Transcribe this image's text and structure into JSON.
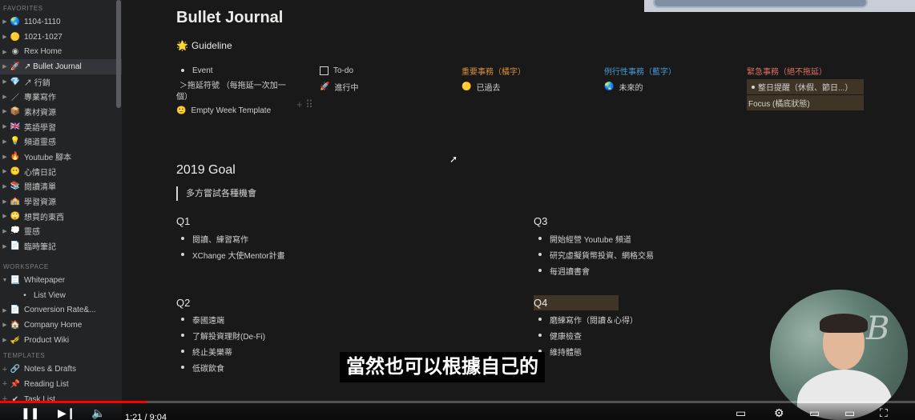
{
  "sidebar": {
    "favorites_label": "FAVORITES",
    "favorites": [
      {
        "icon": "globe-icon",
        "glyph": "🌏",
        "label": "1104-1110",
        "active": false
      },
      {
        "icon": "yellow-circle-icon",
        "glyph": "🟡",
        "label": "1021-1027",
        "active": false
      },
      {
        "icon": "avatar-icon",
        "glyph": "◉",
        "label": "Rex Home",
        "active": false
      },
      {
        "icon": "rocket-icon",
        "glyph": "🚀",
        "label": "↗ Bullet Journal",
        "active": true
      },
      {
        "icon": "diamond-icon",
        "glyph": "💎",
        "label": "↗ 行銷",
        "active": false
      },
      {
        "icon": "pen-icon",
        "glyph": "／",
        "label": "專業寫作",
        "active": false
      },
      {
        "icon": "box-icon",
        "glyph": "📦",
        "label": "素材資源",
        "active": false
      },
      {
        "icon": "uk-flag-icon",
        "glyph": "🇬🇧",
        "label": "英語學習",
        "active": false
      },
      {
        "icon": "lightbulb-icon",
        "glyph": "💡",
        "label": "頻道靈感",
        "active": false
      },
      {
        "icon": "fire-icon",
        "glyph": "🔥",
        "label": "Youtube 腳本",
        "active": false
      },
      {
        "icon": "smiley-icon",
        "glyph": "😶",
        "label": "心情日記",
        "active": false
      },
      {
        "icon": "books-icon",
        "glyph": "📚",
        "label": "閱讀清單",
        "active": false
      },
      {
        "icon": "school-icon",
        "glyph": "🏫",
        "label": "學習資源",
        "active": false
      },
      {
        "icon": "thinking-face-icon",
        "glyph": "🙄",
        "label": "想買的東西",
        "active": false
      },
      {
        "icon": "speech-bubble-icon",
        "glyph": "💭",
        "label": "靈感",
        "active": false
      },
      {
        "icon": "page-icon",
        "glyph": "📄",
        "label": "臨時筆記",
        "active": false
      }
    ],
    "workspace_label": "WORKSPACE",
    "workspace": [
      {
        "icon": "page-icon",
        "glyph": "📃",
        "label": "Whitepaper",
        "expanded": true,
        "sub": false
      },
      {
        "icon": "dot-icon",
        "glyph": "•",
        "label": "List View",
        "expanded": false,
        "sub": true
      },
      {
        "icon": "page-icon",
        "glyph": "📄",
        "label": "Conversion Rate&...",
        "expanded": false,
        "sub": false
      },
      {
        "icon": "house-icon",
        "glyph": "🏠",
        "label": "Company Home",
        "expanded": false,
        "sub": false
      },
      {
        "icon": "trumpet-icon",
        "glyph": "🎺",
        "label": "Product Wiki",
        "expanded": false,
        "sub": false
      }
    ],
    "templates_label": "TEMPLATES",
    "templates": [
      {
        "icon": "link-icon",
        "glyph": "🔗",
        "label": "Notes & Drafts"
      },
      {
        "icon": "bookmark-icon",
        "glyph": "📌",
        "label": "Reading List"
      },
      {
        "icon": "check-icon",
        "glyph": "✔",
        "label": "Task List"
      }
    ]
  },
  "page": {
    "title": "Bullet Journal",
    "guideline": {
      "icon": "sparkle-icon",
      "glyph": "🌟",
      "label": "Guideline"
    },
    "col1": {
      "event": "Event",
      "postpone": "＞拖延符號 （每拖延一次加一",
      "postpone_cont": "個）",
      "template_icon": "🙂",
      "template": "Empty Week Template"
    },
    "col2": {
      "todo": "To-do",
      "in_progress": "進行中",
      "in_progress_glyph": "🚀"
    },
    "col3": {
      "header": "重要事務（橘字）",
      "item": "已過去",
      "item_glyph": "🟡"
    },
    "col4": {
      "header": "例行性事務（藍字）",
      "item": "未來的",
      "item_glyph": "🌏"
    },
    "col5": {
      "header": "緊急事務（絕不拖延）",
      "item1": "整日提醒（休假、節日...）",
      "item2": "Focus (橘底狀態)"
    },
    "goal_title": "2019 Goal",
    "quote": "多方嘗試各種機會",
    "q1": {
      "title": "Q1",
      "items": [
        "閱讀、練習寫作",
        "XChange 大使Mentor計畫"
      ]
    },
    "q2": {
      "title": "Q2",
      "items": [
        "泰國遠端",
        "了解投資理財(De-Fi)",
        "終止美樂蒂",
        "低碳飲食"
      ]
    },
    "q3": {
      "title": "Q3",
      "items": [
        "開始經營 Youtube 頻道",
        "研究虛擬貨幣投資、網格交易",
        "每週讀書會"
      ]
    },
    "q4": {
      "title": "Q4",
      "items": [
        "磨練寫作（閱讀＆心得）",
        "健康檢查",
        "維持體態"
      ]
    }
  },
  "video": {
    "subtitle": "當然也可以根據自己的",
    "time": "1:21 / 9:04",
    "progress": 0.16,
    "webcam_text": "B"
  }
}
